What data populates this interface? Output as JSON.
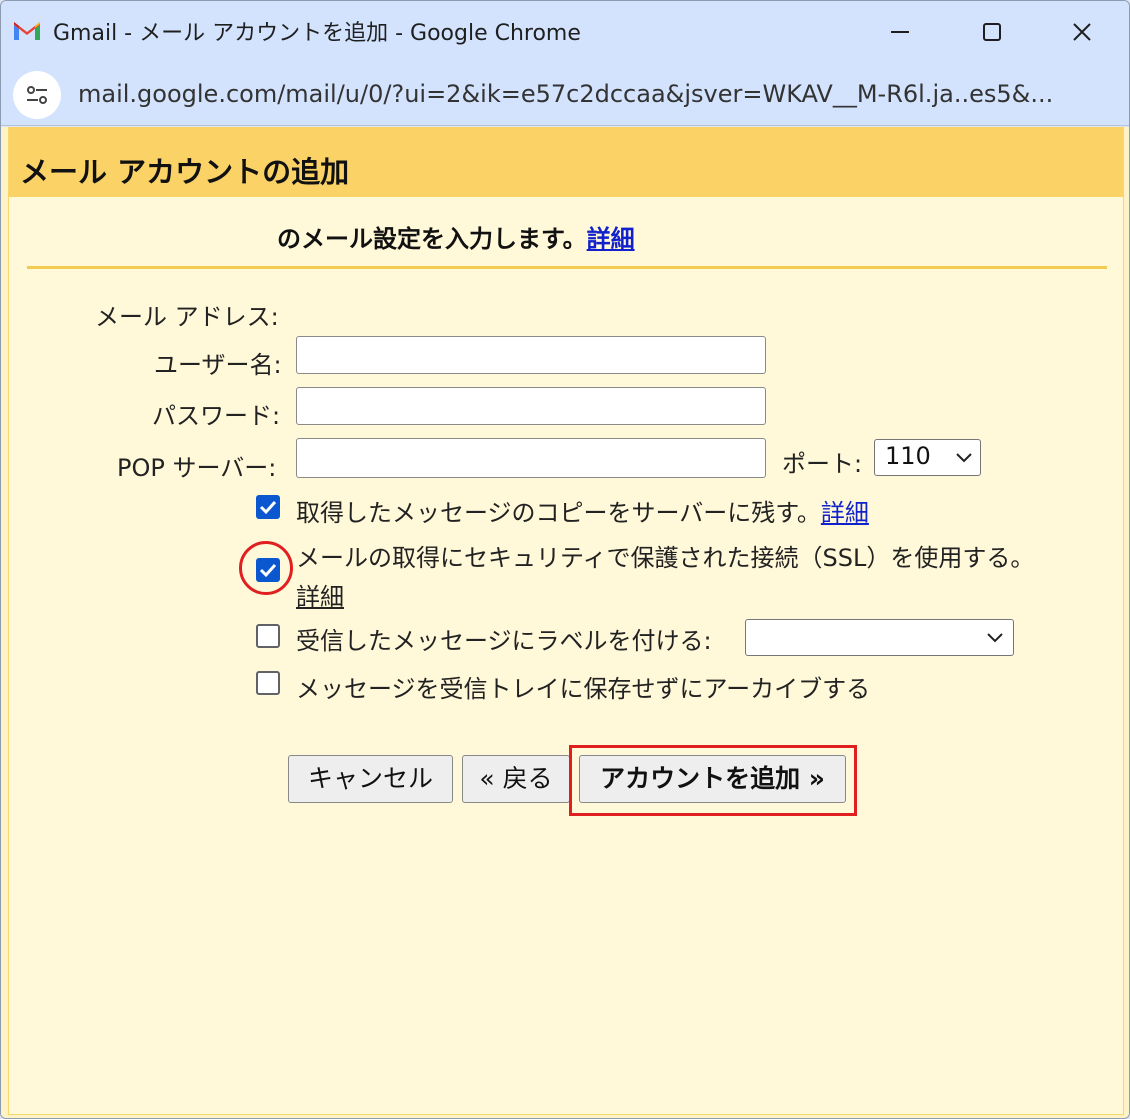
{
  "window": {
    "title": "Gmail - メール アカウントを追加 - Google Chrome",
    "url": "mail.google.com/mail/u/0/?ui=2&ik=e57c2dccaa&jsver=WKAV__M-R6l.ja..es5&..."
  },
  "dialog": {
    "title": "メール アカウントの追加",
    "intro_text": "のメール設定を入力します。",
    "intro_link": "詳細"
  },
  "form": {
    "email_label": "メール アドレス:",
    "username_label": "ユーザー名:",
    "username_value": "",
    "password_label": "パスワード:",
    "password_value": "",
    "pop_server_label": "POP サーバー:",
    "pop_server_value": "",
    "port_label": "ポート:",
    "port_value": "110"
  },
  "options": [
    {
      "label": "取得したメッセージのコピーをサーバーに残す。",
      "link": "詳細",
      "checked": true
    },
    {
      "label": "メールの取得にセキュリティで保護された接続（SSL）を使用する。",
      "link": "詳細",
      "checked": true
    },
    {
      "label": "受信したメッセージにラベルを付ける:",
      "checked": false,
      "select_value": ""
    },
    {
      "label": "メッセージを受信トレイに保存せずにアーカイブする",
      "checked": false
    }
  ],
  "buttons": {
    "cancel": "キャンセル",
    "back": "« 戻る",
    "add_account": "アカウントを追加 »"
  },
  "colors": {
    "header_band": "#fad266",
    "panel": "#fff8d9",
    "checkbox": "#0b57d0",
    "annotation": "#e02020"
  }
}
